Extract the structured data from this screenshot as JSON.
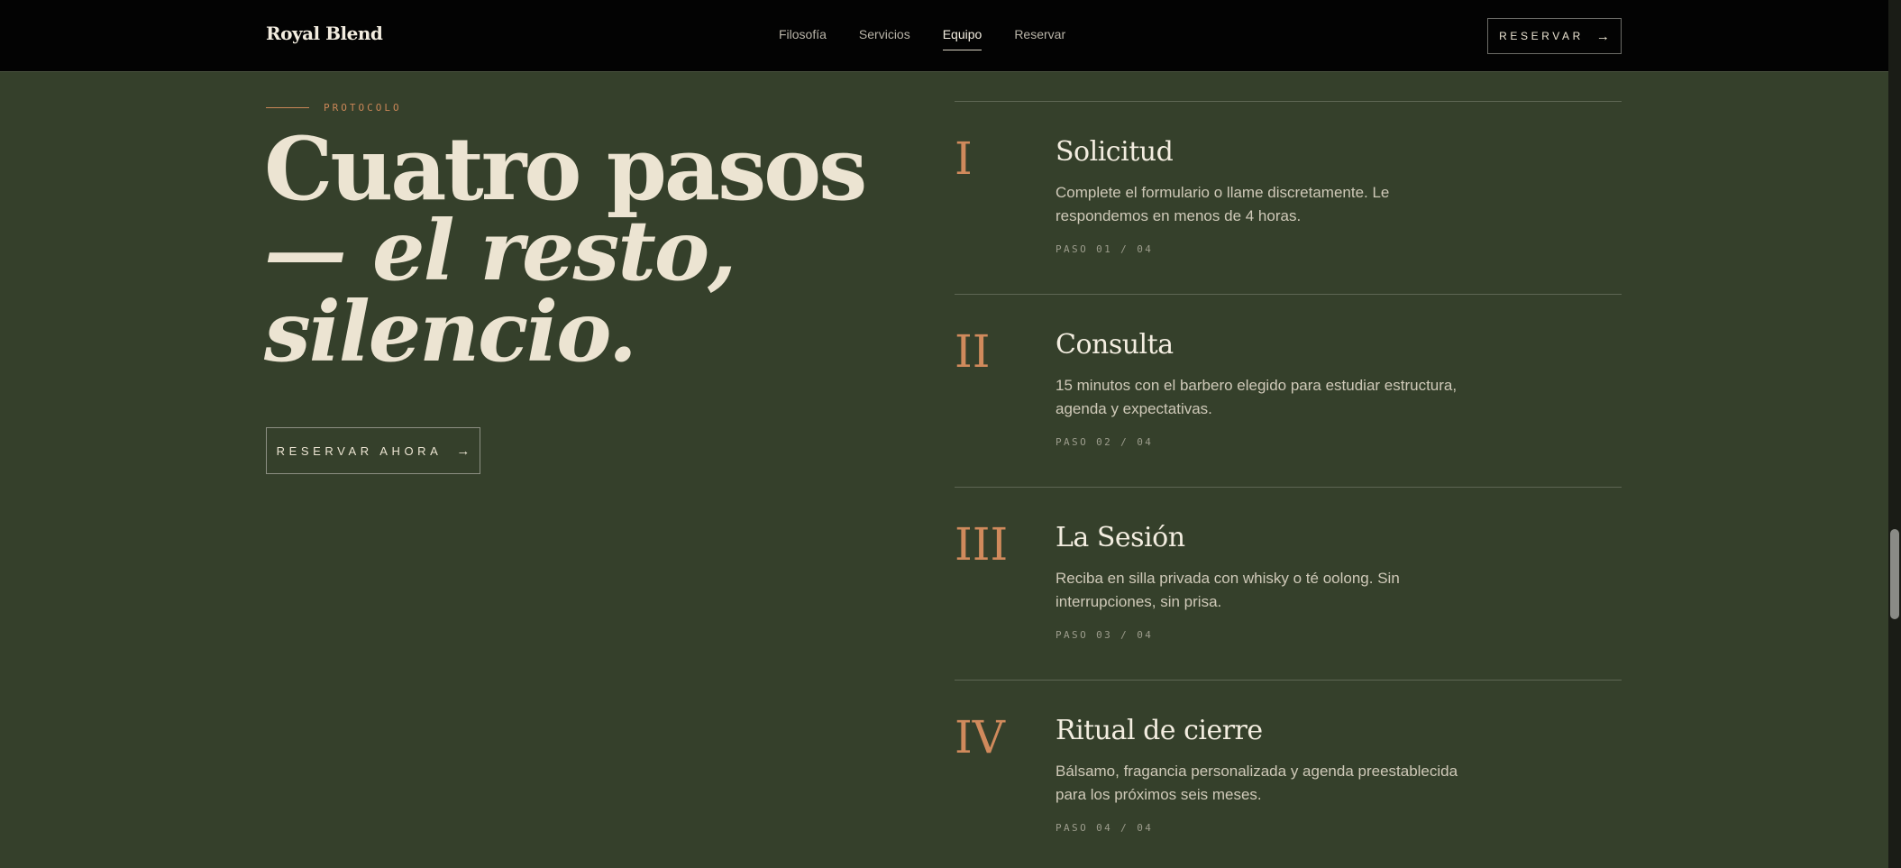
{
  "header": {
    "brand": "Royal Blend",
    "nav": [
      "Filosofía",
      "Servicios",
      "Equipo",
      "Reservar"
    ],
    "active_nav": "Equipo",
    "cta_label": "RESERVAR",
    "cta_arrow": "→"
  },
  "hero": {
    "eyebrow": "PROTOCOLO",
    "title_line1": "Cuatro pasos",
    "title_line2": "— el resto,",
    "title_line3": "silencio.",
    "cta_label": "RESERVAR AHORA",
    "cta_arrow": "→"
  },
  "steps": [
    {
      "numeral": "I",
      "title": "Solicitud",
      "description": "Complete el formulario o llame discretamente. Le respondemos en menos de 4 horas.",
      "meta": "PASO 01 / 04"
    },
    {
      "numeral": "II",
      "title": "Consulta",
      "description": "15 minutos con el barbero elegido para estudiar estructura, agenda y expectativas.",
      "meta": "PASO 02 / 04"
    },
    {
      "numeral": "III",
      "title": "La Sesión",
      "description": "Reciba en silla privada con whisky o té oolong. Sin interrupciones, sin prisa.",
      "meta": "PASO 03 / 04"
    },
    {
      "numeral": "IV",
      "title": "Ritual de cierre",
      "description": "Bálsamo, fragancia personalizada y agenda preestablecida para los próximos seis meses.",
      "meta": "PASO 04 / 04"
    }
  ],
  "colors": {
    "background": "#35402b",
    "header": "#030303",
    "accent": "#d08a5c",
    "text": "#ece4d2"
  }
}
